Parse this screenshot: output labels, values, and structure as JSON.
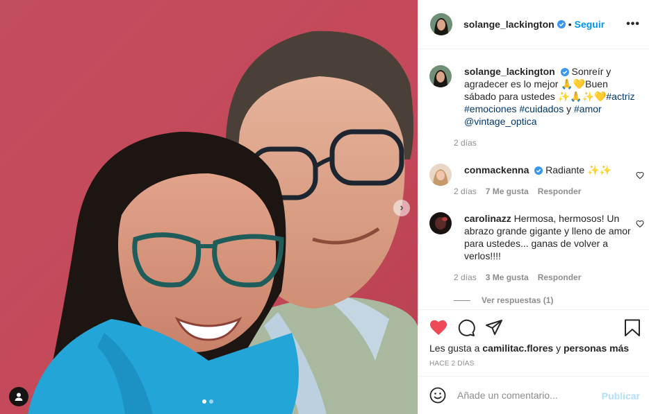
{
  "post": {
    "username": "solange_lackington",
    "follow_label": "Seguir",
    "separator": "•",
    "more_label": "•••"
  },
  "caption": {
    "username": "solange_lackington",
    "text_1": "Sonreír y agradecer es lo mejor 🙏💛Buen sábado para ustedes ✨🙏✨💛",
    "tag_1": "#actriz",
    "tag_2": "#emociones",
    "tag_3": "#cuidados",
    "connector": "y",
    "tag_4": "#amor",
    "mention": "@vintage_optica",
    "time": "2 días"
  },
  "comments": [
    {
      "username": "conmackenna",
      "text": "Radiante ✨✨",
      "time": "2 días",
      "likes": "7 Me gusta",
      "reply_label": "Responder"
    },
    {
      "username": "carolinazz",
      "text": "Hermosa, hermosos! Un abrazo grande gigante y lleno de amor para ustedes... ganas de volver a verlos!!!!",
      "time": "2 días",
      "likes": "3 Me gusta",
      "reply_label": "Responder",
      "view_replies": "Ver respuestas (1)"
    }
  ],
  "likes_line": {
    "prefix": "Les gusta a",
    "user": "camilitac.flores",
    "middle": "y",
    "rest": "personas más"
  },
  "posted": "HACE 2 DÍAS",
  "add_comment": {
    "placeholder": "Añade un comentario...",
    "publish_label": "Publicar"
  },
  "carousel": {
    "count": 2,
    "active_index": 0,
    "next_label": "›"
  },
  "colors": {
    "like_red": "#ed4956",
    "link_blue": "#0095f6",
    "tag_blue": "#00376b",
    "verified_blue": "#3897f0",
    "muted": "#8e8e8e",
    "wall": "#c44a5c"
  }
}
